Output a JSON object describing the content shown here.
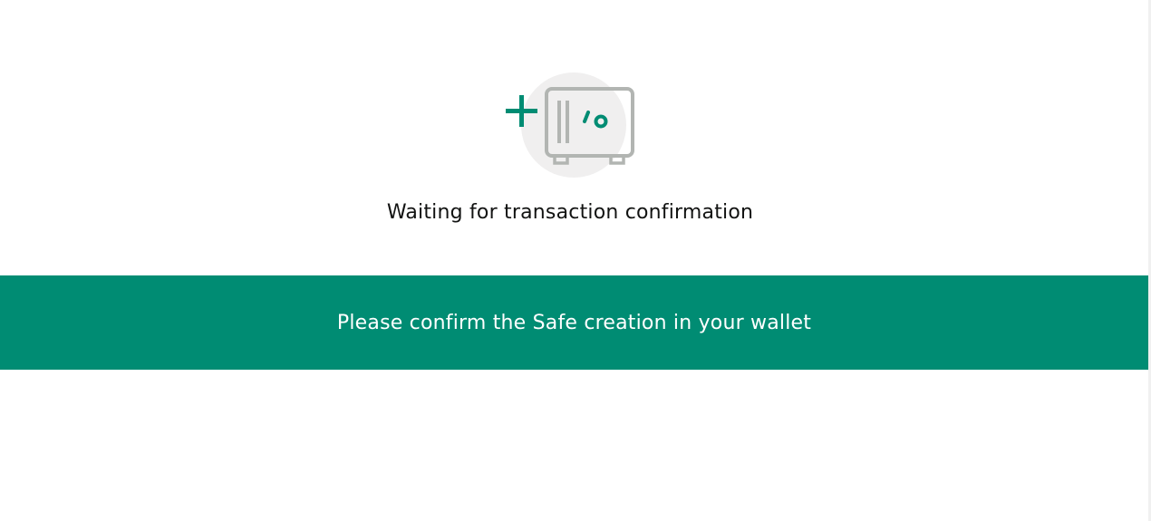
{
  "status": {
    "message": "Waiting for transaction confirmation"
  },
  "banner": {
    "message": "Please confirm the Safe creation in your wallet",
    "color": "#008c73"
  },
  "illustration": {
    "icon": "safe-creation-icon",
    "accent_color": "#008c73",
    "line_color": "#b2b5b2"
  }
}
